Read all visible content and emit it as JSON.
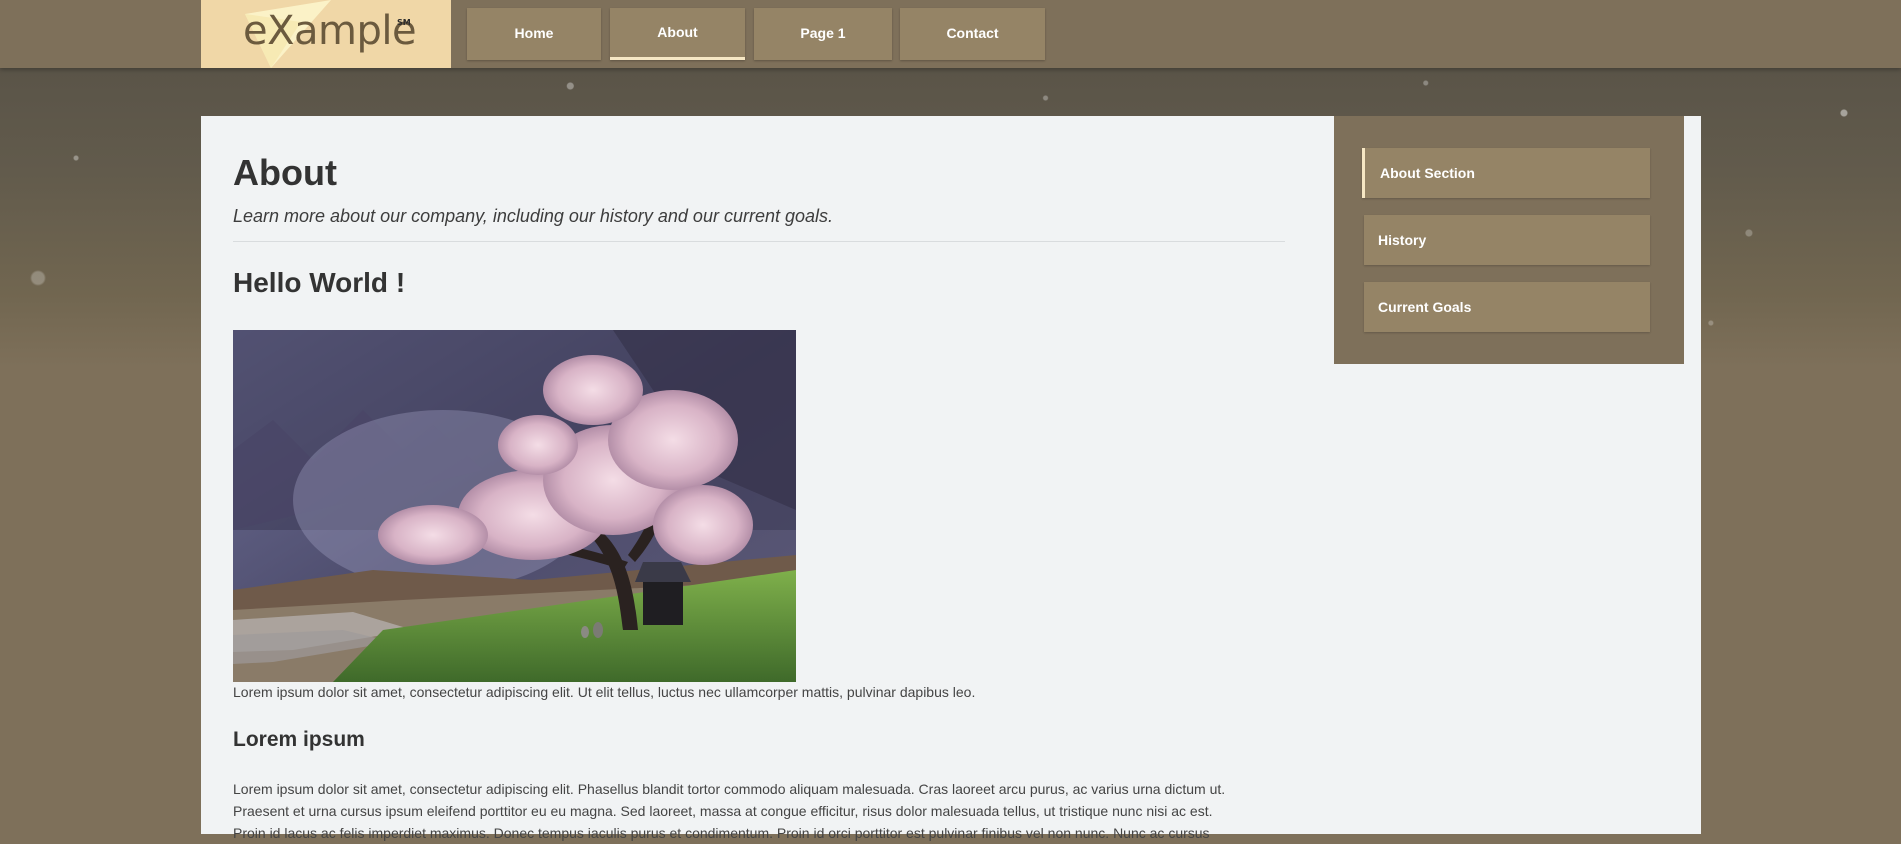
{
  "header": {
    "logo_text": "eXample",
    "logo_mark": "SM",
    "nav": [
      {
        "label": "Home",
        "active": false
      },
      {
        "label": "About",
        "active": true
      },
      {
        "label": "Page 1",
        "active": false
      },
      {
        "label": "Contact",
        "active": false
      }
    ]
  },
  "main": {
    "title": "About",
    "subtitle": "Learn more about our company, including our history and our current goals.",
    "section_heading": "Hello World !",
    "image_caption": "Lorem ipsum dolor sit amet, consectetur adipiscing elit. Ut elit tellus, luctus nec ullamcorper mattis, pulvinar dapibus leo.",
    "subheading": "Lorem ipsum",
    "paragraph_lines": [
      "Lorem ipsum dolor sit amet, consectetur adipiscing elit. Phasellus blandit tortor commodo aliquam malesuada. Cras laoreet arcu purus, ac varius urna dictum ut.",
      "Praesent et urna cursus ipsum eleifend porttitor eu eu magna. Sed laoreet, massa at congue efficitur, risus dolor malesuada tellus, ut tristique nunc nisi ac est.",
      "Proin id lacus ac felis imperdiet maximus. Donec tempus iaculis purus et condimentum. Proin id orci porttitor est pulvinar finibus vel non nunc. Nunc ac cursus"
    ]
  },
  "sidebar": {
    "items": [
      {
        "label": "About Section",
        "active": true
      },
      {
        "label": "History",
        "active": false
      },
      {
        "label": "Current Goals",
        "active": false
      }
    ]
  },
  "colors": {
    "page_background": "#7e705a",
    "logo_background": "#f0d7a7",
    "nav_button": "#958466",
    "active_indicator": "#f6e7c4",
    "content_background": "#f1f3f4",
    "heading_text": "#333333"
  }
}
